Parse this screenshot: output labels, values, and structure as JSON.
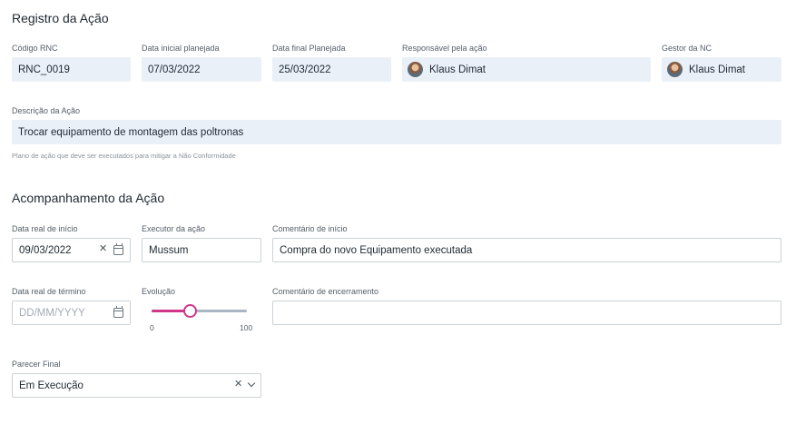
{
  "registro": {
    "title": "Registro da Ação",
    "codigo_rnc": {
      "label": "Código RNC",
      "value": "RNC_0019"
    },
    "data_inicial": {
      "label": "Data inicial planejada",
      "value": "07/03/2022"
    },
    "data_final": {
      "label": "Data final Planejada",
      "value": "25/03/2022"
    },
    "responsavel": {
      "label": "Responsável pela ação",
      "value": "Klaus Dimat"
    },
    "gestor": {
      "label": "Gestor da NC",
      "value": "Klaus Dimat"
    },
    "descricao": {
      "label": "Descrição da Ação",
      "value": "Trocar equipamento de montagem das poltronas"
    },
    "hint": "Plano de ação que deve ser executados para mitigar a Não Conformidade"
  },
  "acompanhamento": {
    "title": "Acompanhamento da Ação",
    "data_real_inicio": {
      "label": "Data real de início",
      "value": "09/03/2022"
    },
    "executor": {
      "label": "Executor da ação",
      "value": "Mussum"
    },
    "comentario_inicio": {
      "label": "Comentário de início",
      "value": "Compra do novo Equipamento executada"
    },
    "data_real_termino": {
      "label": "Data real de término",
      "placeholder": "DD/MM/YYYY"
    },
    "evolucao": {
      "label": "Evolução",
      "value_percent": 40,
      "min_label": "0",
      "max_label": "100"
    },
    "comentario_encerramento": {
      "label": "Comentário de encerramento",
      "value": ""
    },
    "parecer_final": {
      "label": "Parecer Final",
      "value": "Em Execução"
    }
  },
  "colors": {
    "accent": "#d0368a",
    "readonly_bg": "#eaf0f8",
    "track": "#a9b6c4"
  },
  "icons": {
    "clear": "close-icon",
    "calendar": "calendar-icon",
    "dropdown": "chevron-down-icon"
  }
}
